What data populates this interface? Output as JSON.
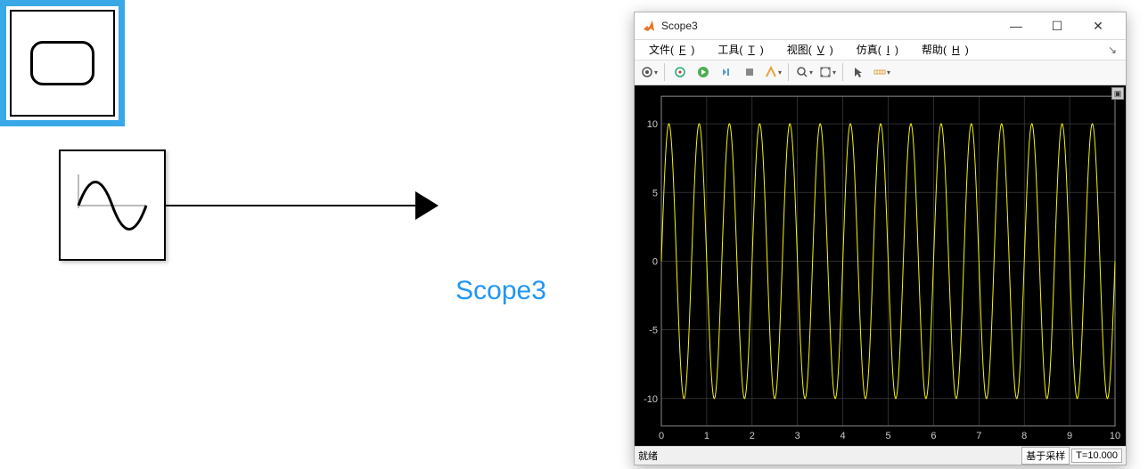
{
  "simulink": {
    "scope_block_label": "Scope3"
  },
  "scope_window": {
    "title": "Scope3",
    "menus": {
      "file": "文件(F)",
      "tools": "工具(T)",
      "view": "视图(V)",
      "simulation": "仿真(I)",
      "help": "帮助(H)"
    },
    "toolbar": {
      "settings": "gear-icon",
      "target": "target-icon",
      "run": "run-icon",
      "step": "step-icon",
      "stop": "stop-icon",
      "highlight": "highlight-icon",
      "zoom": "zoom-icon",
      "autoscale": "autoscale-icon",
      "cursor": "cursor-icon",
      "measure": "measure-icon"
    },
    "status": {
      "ready": "就绪",
      "sample": "基于采样",
      "time_label": "T=10.000"
    },
    "win_controls": {
      "min": "—",
      "max": "☐",
      "close": "✕"
    }
  },
  "chart_data": {
    "type": "line",
    "title": "",
    "xlabel": "",
    "ylabel": "",
    "xlim": [
      0,
      10
    ],
    "ylim": [
      -12,
      12
    ],
    "x_ticks": [
      0,
      1,
      2,
      3,
      4,
      5,
      6,
      7,
      8,
      9,
      10
    ],
    "y_ticks": [
      -10,
      -5,
      0,
      5,
      10
    ],
    "signal": {
      "name": "sine",
      "amplitude": 10,
      "frequency_hz": 1.5,
      "phase": 0,
      "color": "#f5f50a"
    },
    "grid": true,
    "grid_color": "#4a4a4a",
    "line_color": "#f5f50a",
    "background": "#000000"
  }
}
